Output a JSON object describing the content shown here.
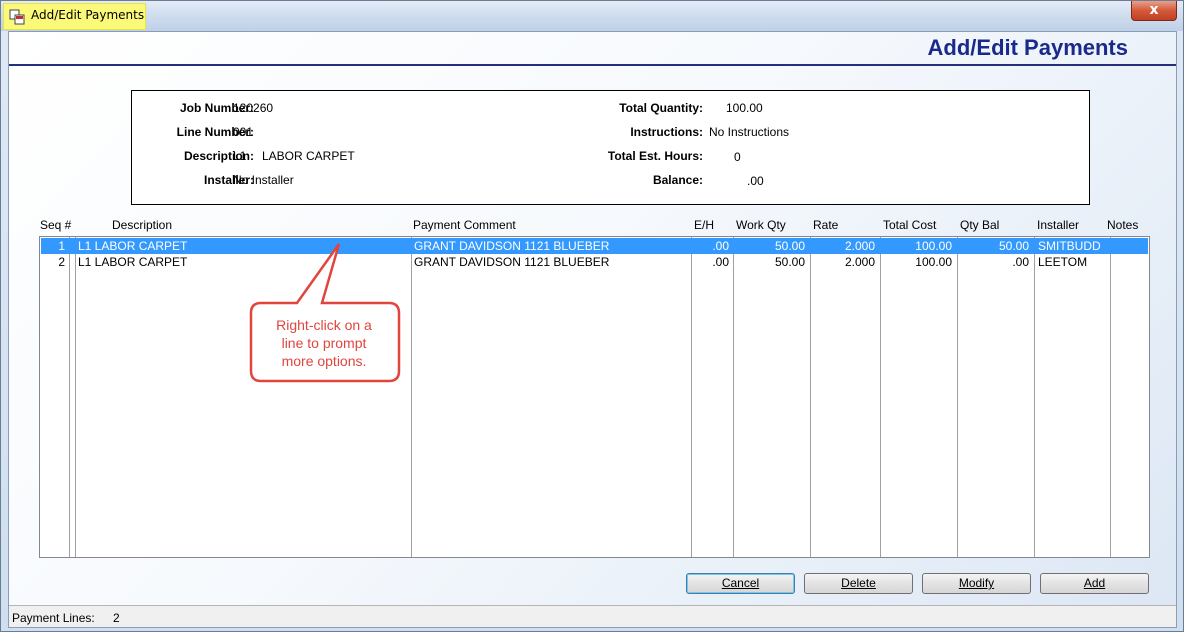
{
  "window": {
    "title": "Add/Edit Payments",
    "close_label": "x"
  },
  "header": {
    "title": "Add/Edit Payments"
  },
  "info": {
    "job_number_label": "Job Number:",
    "job_number": "120260",
    "line_number_label": "Line Number:",
    "line_number": "001",
    "description_label": "Description:",
    "description_code": "L1",
    "description_text": "LABOR CARPET",
    "installer_label": "Installer:",
    "installer": "No Installer",
    "total_quantity_label": "Total Quantity:",
    "total_quantity": "100.00",
    "instructions_label": "Instructions:",
    "instructions": "No Instructions",
    "total_est_hours_label": "Total Est. Hours:",
    "total_est_hours": "0",
    "balance_label": "Balance:",
    "balance": ".00"
  },
  "columns": {
    "seq": "Seq #",
    "description": "Description",
    "payment_comment": "Payment Comment",
    "eh": "E/H",
    "work_qty": "Work Qty",
    "rate": "Rate",
    "total_cost": "Total Cost",
    "qty_bal": "Qty Bal",
    "installer": "Installer",
    "notes": "Notes"
  },
  "rows": [
    {
      "seq": "1",
      "description": "L1  LABOR CARPET",
      "payment_comment": "GRANT DAVIDSON 1121 BLUEBER",
      "eh": ".00",
      "work_qty": "50.00",
      "rate": "2.000",
      "total_cost": "100.00",
      "qty_bal": "50.00",
      "installer": "SMITBUDD",
      "notes": ""
    },
    {
      "seq": "2",
      "description": "L1  LABOR CARPET",
      "payment_comment": "GRANT DAVIDSON 1121 BLUEBER",
      "eh": ".00",
      "work_qty": "50.00",
      "rate": "2.000",
      "total_cost": "100.00",
      "qty_bal": ".00",
      "installer": "LEETOM",
      "notes": ""
    }
  ],
  "callout": {
    "line1": "Right-click on a",
    "line2": "line to prompt",
    "line3": "more options.",
    "color": "#e0453e"
  },
  "buttons": {
    "cancel": "Cancel",
    "delete": "Delete",
    "modify": "Modify",
    "add": "Add"
  },
  "status": {
    "label": "Payment Lines:",
    "count": "2"
  },
  "colors": {
    "header_title": "#1a2a8c",
    "selection": "#3399ff",
    "title_highlight": "#fbf97a"
  }
}
